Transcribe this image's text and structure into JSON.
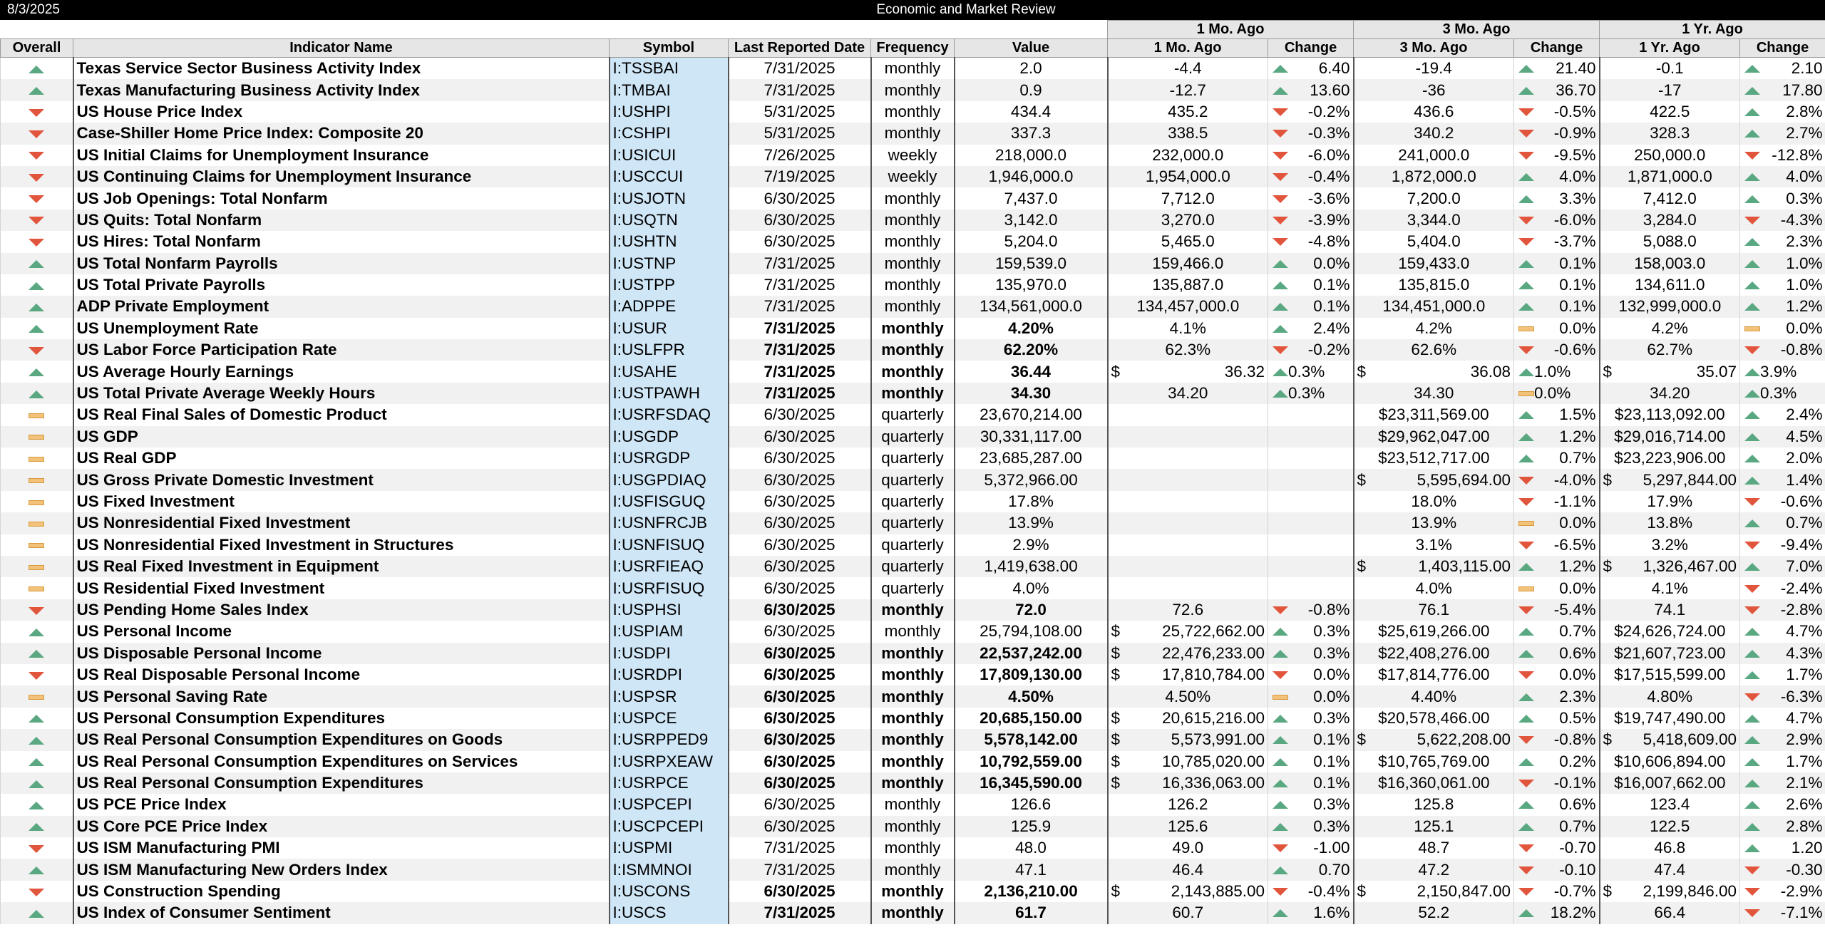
{
  "header": {
    "date": "8/3/2025",
    "title": "Economic and Market Review"
  },
  "groups": {
    "one_month": "1 Mo. Ago",
    "three_month": "3 Mo. Ago",
    "one_year": "1 Yr. Ago"
  },
  "columns": {
    "overall": "Overall",
    "name": "Indicator Name",
    "symbol": "Symbol",
    "date": "Last Reported Date",
    "frequency": "Frequency",
    "value": "Value",
    "one_month": "1 Mo. Ago",
    "change1": "Change",
    "three_month": "3 Mo. Ago",
    "change3": "Change",
    "one_year": "1 Yr. Ago",
    "change12": "Change"
  },
  "colors": {
    "up": "#5aa882",
    "down": "#e2553d",
    "flat": "#f2c27a",
    "symbol_bg": "#cfe6f7"
  },
  "rows": [
    {
      "ov": "up",
      "nm": "Texas Service Sector Business Activity Index",
      "sy": "I:TSSBAI",
      "dt": "7/31/2025",
      "fr": "monthly",
      "vl": "2.0",
      "v1": "-4.4",
      "i1": "up",
      "g1": "6.40",
      "v3": "-19.4",
      "i3": "up",
      "g3": "21.40",
      "v12": "-0.1",
      "i12": "up",
      "g12": "2.10"
    },
    {
      "ov": "up",
      "nm": "Texas Manufacturing Business Activity Index",
      "sy": "I:TMBAI",
      "dt": "7/31/2025",
      "fr": "monthly",
      "vl": "0.9",
      "v1": "-12.7",
      "i1": "up",
      "g1": "13.60",
      "v3": "-36",
      "i3": "up",
      "g3": "36.70",
      "v12": "-17",
      "i12": "up",
      "g12": "17.80"
    },
    {
      "ov": "down",
      "nm": "US House Price Index",
      "sy": "I:USHPI",
      "dt": "5/31/2025",
      "fr": "monthly",
      "vl": "434.4",
      "v1": "435.2",
      "i1": "down",
      "g1": "-0.2%",
      "v3": "436.6",
      "i3": "down",
      "g3": "-0.5%",
      "v12": "422.5",
      "i12": "up",
      "g12": "2.8%"
    },
    {
      "ov": "down",
      "nm": "Case-Shiller Home Price Index: Composite 20",
      "sy": "I:CSHPI",
      "dt": "5/31/2025",
      "fr": "monthly",
      "vl": "337.3",
      "v1": "338.5",
      "i1": "down",
      "g1": "-0.3%",
      "v3": "340.2",
      "i3": "down",
      "g3": "-0.9%",
      "v12": "328.3",
      "i12": "up",
      "g12": "2.7%"
    },
    {
      "ov": "down",
      "nm": "US Initial Claims for Unemployment Insurance",
      "sy": "I:USICUI",
      "dt": "7/26/2025",
      "fr": "weekly",
      "vl": "218,000.0",
      "v1": "232,000.0",
      "i1": "down",
      "g1": "-6.0%",
      "v3": "241,000.0",
      "i3": "down",
      "g3": "-9.5%",
      "v12": "250,000.0",
      "i12": "down",
      "g12": "-12.8%"
    },
    {
      "ov": "down",
      "nm": "US Continuing Claims for Unemployment Insurance",
      "sy": "I:USCCUI",
      "dt": "7/19/2025",
      "fr": "weekly",
      "vl": "1,946,000.0",
      "v1": "1,954,000.0",
      "i1": "down",
      "g1": "-0.4%",
      "v3": "1,872,000.0",
      "i3": "up",
      "g3": "4.0%",
      "v12": "1,871,000.0",
      "i12": "up",
      "g12": "4.0%"
    },
    {
      "ov": "down",
      "nm": "US Job Openings: Total Nonfarm",
      "sy": "I:USJOTN",
      "dt": "6/30/2025",
      "fr": "monthly",
      "vl": "7,437.0",
      "v1": "7,712.0",
      "i1": "down",
      "g1": "-3.6%",
      "v3": "7,200.0",
      "i3": "up",
      "g3": "3.3%",
      "v12": "7,412.0",
      "i12": "up",
      "g12": "0.3%"
    },
    {
      "ov": "down",
      "nm": "US Quits: Total Nonfarm",
      "sy": "I:USQTN",
      "dt": "6/30/2025",
      "fr": "monthly",
      "vl": "3,142.0",
      "v1": "3,270.0",
      "i1": "down",
      "g1": "-3.9%",
      "v3": "3,344.0",
      "i3": "down",
      "g3": "-6.0%",
      "v12": "3,284.0",
      "i12": "down",
      "g12": "-4.3%"
    },
    {
      "ov": "down",
      "nm": "US Hires: Total Nonfarm",
      "sy": "I:USHTN",
      "dt": "6/30/2025",
      "fr": "monthly",
      "vl": "5,204.0",
      "v1": "5,465.0",
      "i1": "down",
      "g1": "-4.8%",
      "v3": "5,404.0",
      "i3": "down",
      "g3": "-3.7%",
      "v12": "5,088.0",
      "i12": "up",
      "g12": "2.3%"
    },
    {
      "ov": "up",
      "nm": "US Total Nonfarm Payrolls",
      "sy": "I:USTNP",
      "dt": "7/31/2025",
      "fr": "monthly",
      "vl": "159,539.0",
      "v1": "159,466.0",
      "i1": "up",
      "g1": "0.0%",
      "v3": "159,433.0",
      "i3": "up",
      "g3": "0.1%",
      "v12": "158,003.0",
      "i12": "up",
      "g12": "1.0%"
    },
    {
      "ov": "up",
      "nm": "US Total Private Payrolls",
      "sy": "I:USTPP",
      "dt": "7/31/2025",
      "fr": "monthly",
      "vl": "135,970.0",
      "v1": "135,887.0",
      "i1": "up",
      "g1": "0.1%",
      "v3": "135,815.0",
      "i3": "up",
      "g3": "0.1%",
      "v12": "134,611.0",
      "i12": "up",
      "g12": "1.0%"
    },
    {
      "ov": "up",
      "nm": "ADP Private Employment",
      "sy": "I:ADPPE",
      "dt": "7/31/2025",
      "fr": "monthly",
      "vl": "134,561,000.0",
      "v1": "134,457,000.0",
      "i1": "up",
      "g1": "0.1%",
      "v3": "134,451,000.0",
      "i3": "up",
      "g3": "0.1%",
      "v12": "132,999,000.0",
      "i12": "up",
      "g12": "1.2%"
    },
    {
      "ov": "up",
      "b": true,
      "nm": "US Unemployment Rate",
      "sy": "I:USUR",
      "dt": "7/31/2025",
      "fr": "monthly",
      "vl": "4.20%",
      "v1": "4.1%",
      "i1": "up",
      "g1": "2.4%",
      "v3": "4.2%",
      "i3": "flat",
      "g3": "0.0%",
      "v12": "4.2%",
      "i12": "flat",
      "g12": "0.0%"
    },
    {
      "ov": "down",
      "b": true,
      "nm": "US Labor Force Participation Rate",
      "sy": "I:USLFPR",
      "dt": "7/31/2025",
      "fr": "monthly",
      "vl": "62.20%",
      "v1": "62.3%",
      "i1": "down",
      "g1": "-0.2%",
      "v3": "62.6%",
      "i3": "down",
      "g3": "-0.6%",
      "v12": "62.7%",
      "i12": "down",
      "g12": "-0.8%"
    },
    {
      "ov": "up",
      "b": true,
      "nm": "US Average Hourly Earnings",
      "sy": "I:USAHE",
      "dt": "7/31/2025",
      "fr": "monthly",
      "vl": "36.44",
      "vc": "$",
      "v1": "36.32",
      "v1c": "$",
      "i1": "up",
      "g1": "0.3%",
      "g1l": true,
      "v3": "36.08",
      "v3c": "$",
      "i3": "up",
      "g3": "1.0%",
      "g3l": true,
      "v12": "35.07",
      "v12c": "$",
      "i12": "up",
      "g12": "3.9%",
      "g12l": true
    },
    {
      "ov": "up",
      "b": true,
      "nm": "US Total Private Average Weekly Hours",
      "sy": "I:USTPAWH",
      "dt": "7/31/2025",
      "fr": "monthly",
      "vl": "34.30",
      "v1": "34.20",
      "i1": "up",
      "g1": "0.3%",
      "g1l": true,
      "v3": "34.30",
      "i3": "flat",
      "g3": "0.0%",
      "g3l": true,
      "v12": "34.20",
      "i12": "up",
      "g12": "0.3%",
      "g12l": true
    },
    {
      "ov": "flat",
      "nm": "US Real Final Sales of Domestic Product",
      "sy": "I:USRFSDAQ",
      "dt": "6/30/2025",
      "fr": "quarterly",
      "vl": "23,670,214.00",
      "vc": "$",
      "v1": "",
      "i1": "",
      "g1": "",
      "v3": "$23,311,569.00",
      "i3": "up",
      "g3": "1.5%",
      "v12": "$23,113,092.00",
      "i12": "up",
      "g12": "2.4%"
    },
    {
      "ov": "flat",
      "nm": "US GDP",
      "sy": "I:USGDP",
      "dt": "6/30/2025",
      "fr": "quarterly",
      "vl": "30,331,117.00",
      "vc": "$",
      "v1": "",
      "i1": "",
      "g1": "",
      "v3": "$29,962,047.00",
      "i3": "up",
      "g3": "1.2%",
      "v12": "$29,016,714.00",
      "i12": "up",
      "g12": "4.5%"
    },
    {
      "ov": "flat",
      "nm": "US Real GDP",
      "sy": "I:USRGDP",
      "dt": "6/30/2025",
      "fr": "quarterly",
      "vl": "23,685,287.00",
      "vc": "$",
      "v1": "",
      "i1": "",
      "g1": "",
      "v3": "$23,512,717.00",
      "i3": "up",
      "g3": "0.7%",
      "v12": "$23,223,906.00",
      "i12": "up",
      "g12": "2.0%"
    },
    {
      "ov": "flat",
      "nm": "US Gross Private Domestic Investment",
      "sy": "I:USGPDIAQ",
      "dt": "6/30/2025",
      "fr": "quarterly",
      "vl": "5,372,966.00",
      "vc": "$",
      "v1": "",
      "i1": "",
      "g1": "",
      "v3": "5,595,694.00",
      "v3c": "$",
      "i3": "down",
      "g3": "-4.0%",
      "v12": "5,297,844.00",
      "v12c": "$",
      "i12": "up",
      "g12": "1.4%"
    },
    {
      "ov": "flat",
      "nm": "US Fixed Investment",
      "sy": "I:USFISGUQ",
      "dt": "6/30/2025",
      "fr": "quarterly",
      "vl": "17.8%",
      "v1": "",
      "i1": "",
      "g1": "",
      "v3": "18.0%",
      "i3": "down",
      "g3": "-1.1%",
      "v12": "17.9%",
      "i12": "down",
      "g12": "-0.6%"
    },
    {
      "ov": "flat",
      "nm": "US Nonresidential Fixed Investment",
      "sy": "I:USNFRCJB",
      "dt": "6/30/2025",
      "fr": "quarterly",
      "vl": "13.9%",
      "v1": "",
      "i1": "",
      "g1": "",
      "v3": "13.9%",
      "i3": "flat",
      "g3": "0.0%",
      "v12": "13.8%",
      "i12": "up",
      "g12": "0.7%"
    },
    {
      "ov": "flat",
      "nm": "US Nonresidential Fixed Investment in Structures",
      "sy": "I:USNFISUQ",
      "dt": "6/30/2025",
      "fr": "quarterly",
      "vl": "2.9%",
      "v1": "",
      "i1": "",
      "g1": "",
      "v3": "3.1%",
      "i3": "down",
      "g3": "-6.5%",
      "v12": "3.2%",
      "i12": "down",
      "g12": "-9.4%"
    },
    {
      "ov": "flat",
      "nm": "US Real Fixed Investment in Equipment",
      "sy": "I:USRFIEAQ",
      "dt": "6/30/2025",
      "fr": "quarterly",
      "vl": "1,419,638.00",
      "vc": "$",
      "v1": "",
      "i1": "",
      "g1": "",
      "v3": "1,403,115.00",
      "v3c": "$",
      "i3": "up",
      "g3": "1.2%",
      "v12": "1,326,467.00",
      "v12c": "$",
      "i12": "up",
      "g12": "7.0%"
    },
    {
      "ov": "flat",
      "nm": "US Residential Fixed Investment",
      "sy": "I:USRFISUQ",
      "dt": "6/30/2025",
      "fr": "quarterly",
      "vl": "4.0%",
      "v1": "",
      "i1": "",
      "g1": "",
      "v3": "4.0%",
      "i3": "flat",
      "g3": "0.0%",
      "v12": "4.1%",
      "i12": "down",
      "g12": "-2.4%"
    },
    {
      "ov": "down",
      "b": true,
      "nm": "US Pending Home Sales Index",
      "sy": "I:USPHSI",
      "dt": "6/30/2025",
      "fr": "monthly",
      "vl": "72.0",
      "v1": "72.6",
      "i1": "down",
      "g1": "-0.8%",
      "v3": "76.1",
      "i3": "down",
      "g3": "-5.4%",
      "v12": "74.1",
      "i12": "down",
      "g12": "-2.8%"
    },
    {
      "ov": "up",
      "nm": "US Personal Income",
      "sy": "I:USPIAM",
      "dt": "6/30/2025",
      "fr": "monthly",
      "vl": "25,794,108.00",
      "vc": "$",
      "v1": "25,722,662.00",
      "v1c": "$",
      "i1": "up",
      "g1": "0.3%",
      "v3": "$25,619,266.00",
      "i3": "up",
      "g3": "0.7%",
      "v12": "$24,626,724.00",
      "i12": "up",
      "g12": "4.7%"
    },
    {
      "ov": "up",
      "b": true,
      "nm": "US Disposable Personal Income",
      "sy": "I:USDPI",
      "dt": "6/30/2025",
      "fr": "monthly",
      "vl": "22,537,242.00",
      "vc": "$",
      "v1": "22,476,233.00",
      "v1c": "$",
      "i1": "up",
      "g1": "0.3%",
      "v3": "$22,408,276.00",
      "i3": "up",
      "g3": "0.6%",
      "v12": "$21,607,723.00",
      "i12": "up",
      "g12": "4.3%"
    },
    {
      "ov": "down",
      "b": true,
      "nm": "US Real Disposable Personal Income",
      "sy": "I:USRDPI",
      "dt": "6/30/2025",
      "fr": "monthly",
      "vl": "17,809,130.00",
      "vc": "$",
      "v1": "17,810,784.00",
      "v1c": "$",
      "i1": "down",
      "g1": "0.0%",
      "v3": "$17,814,776.00",
      "i3": "down",
      "g3": "0.0%",
      "v12": "$17,515,599.00",
      "i12": "up",
      "g12": "1.7%"
    },
    {
      "ov": "flat",
      "b": true,
      "nm": "US Personal Saving Rate",
      "sy": "I:USPSR",
      "dt": "6/30/2025",
      "fr": "monthly",
      "vl": "4.50%",
      "v1": "4.50%",
      "i1": "flat",
      "g1": "0.0%",
      "v3": "4.40%",
      "i3": "up",
      "g3": "2.3%",
      "v12": "4.80%",
      "i12": "down",
      "g12": "-6.3%"
    },
    {
      "ov": "up",
      "b": true,
      "nm": "US Personal Consumption Expenditures",
      "sy": "I:USPCE",
      "dt": "6/30/2025",
      "fr": "monthly",
      "vl": "20,685,150.00",
      "vc": "$",
      "v1": "20,615,216.00",
      "v1c": "$",
      "i1": "up",
      "g1": "0.3%",
      "v3": "$20,578,466.00",
      "i3": "up",
      "g3": "0.5%",
      "v12": "$19,747,490.00",
      "i12": "up",
      "g12": "4.7%"
    },
    {
      "ov": "up",
      "b": true,
      "nm": "US Real Personal Consumption Expenditures on Goods",
      "sy": "I:USRPPED9",
      "dt": "6/30/2025",
      "fr": "monthly",
      "vl": "5,578,142.00",
      "vc": "$",
      "v1": "5,573,991.00",
      "v1c": "$",
      "i1": "up",
      "g1": "0.1%",
      "v3": "5,622,208.00",
      "v3c": "$",
      "i3": "down",
      "g3": "-0.8%",
      "v12": "5,418,609.00",
      "v12c": "$",
      "i12": "up",
      "g12": "2.9%"
    },
    {
      "ov": "up",
      "b": true,
      "nm": "US Real Personal Consumption Expenditures on Services",
      "sy": "I:USRPXEAW",
      "dt": "6/30/2025",
      "fr": "monthly",
      "vl": "10,792,559.00",
      "vc": "$",
      "v1": "10,785,020.00",
      "v1c": "$",
      "i1": "up",
      "g1": "0.1%",
      "v3": "$10,765,769.00",
      "i3": "up",
      "g3": "0.2%",
      "v12": "$10,606,894.00",
      "i12": "up",
      "g12": "1.7%"
    },
    {
      "ov": "up",
      "b": true,
      "nm": "US Real Personal Consumption Expenditures",
      "sy": "I:USRPCE",
      "dt": "6/30/2025",
      "fr": "monthly",
      "vl": "16,345,590.00",
      "vc": "$",
      "v1": "16,336,063.00",
      "v1c": "$",
      "i1": "up",
      "g1": "0.1%",
      "v3": "$16,360,061.00",
      "i3": "down",
      "g3": "-0.1%",
      "v12": "$16,007,662.00",
      "i12": "up",
      "g12": "2.1%"
    },
    {
      "ov": "up",
      "nm": "US PCE Price Index",
      "sy": "I:USPCEPI",
      "dt": "6/30/2025",
      "fr": "monthly",
      "vl": "126.6",
      "v1": "126.2",
      "i1": "up",
      "g1": "0.3%",
      "v3": "125.8",
      "i3": "up",
      "g3": "0.6%",
      "v12": "123.4",
      "i12": "up",
      "g12": "2.6%"
    },
    {
      "ov": "up",
      "nm": "US Core PCE Price Index",
      "sy": "I:USCPCEPI",
      "dt": "6/30/2025",
      "fr": "monthly",
      "vl": "125.9",
      "v1": "125.6",
      "i1": "up",
      "g1": "0.3%",
      "v3": "125.1",
      "i3": "up",
      "g3": "0.7%",
      "v12": "122.5",
      "i12": "up",
      "g12": "2.8%"
    },
    {
      "ov": "down",
      "nm": "US ISM Manufacturing PMI",
      "sy": "I:USPMI",
      "dt": "7/31/2025",
      "fr": "monthly",
      "vl": "48.0",
      "v1": "49.0",
      "i1": "down",
      "g1": "-1.00",
      "v3": "48.7",
      "i3": "down",
      "g3": "-0.70",
      "v12": "46.8",
      "i12": "up",
      "g12": "1.20"
    },
    {
      "ov": "up",
      "nm": "US ISM Manufacturing New Orders Index",
      "sy": "I:ISMMNOI",
      "dt": "7/31/2025",
      "fr": "monthly",
      "vl": "47.1",
      "v1": "46.4",
      "i1": "up",
      "g1": "0.70",
      "v3": "47.2",
      "i3": "down",
      "g3": "-0.10",
      "v12": "47.4",
      "i12": "down",
      "g12": "-0.30"
    },
    {
      "ov": "down",
      "b": true,
      "nm": "US Construction Spending",
      "sy": "I:USCONS",
      "dt": "6/30/2025",
      "fr": "monthly",
      "vl": "2,136,210.00",
      "vc": "$",
      "v1": "2,143,885.00",
      "v1c": "$",
      "i1": "down",
      "g1": "-0.4%",
      "v3": "2,150,847.00",
      "v3c": "$",
      "i3": "down",
      "g3": "-0.7%",
      "v12": "2,199,846.00",
      "v12c": "$",
      "i12": "down",
      "g12": "-2.9%"
    },
    {
      "ov": "up",
      "b": true,
      "nm": "US Index of Consumer Sentiment",
      "sy": "I:USCS",
      "dt": "7/31/2025",
      "fr": "monthly",
      "vl": "61.7",
      "v1": "60.7",
      "i1": "up",
      "g1": "1.6%",
      "v3": "52.2",
      "i3": "up",
      "g3": "18.2%",
      "v12": "66.4",
      "i12": "down",
      "g12": "-7.1%"
    }
  ]
}
